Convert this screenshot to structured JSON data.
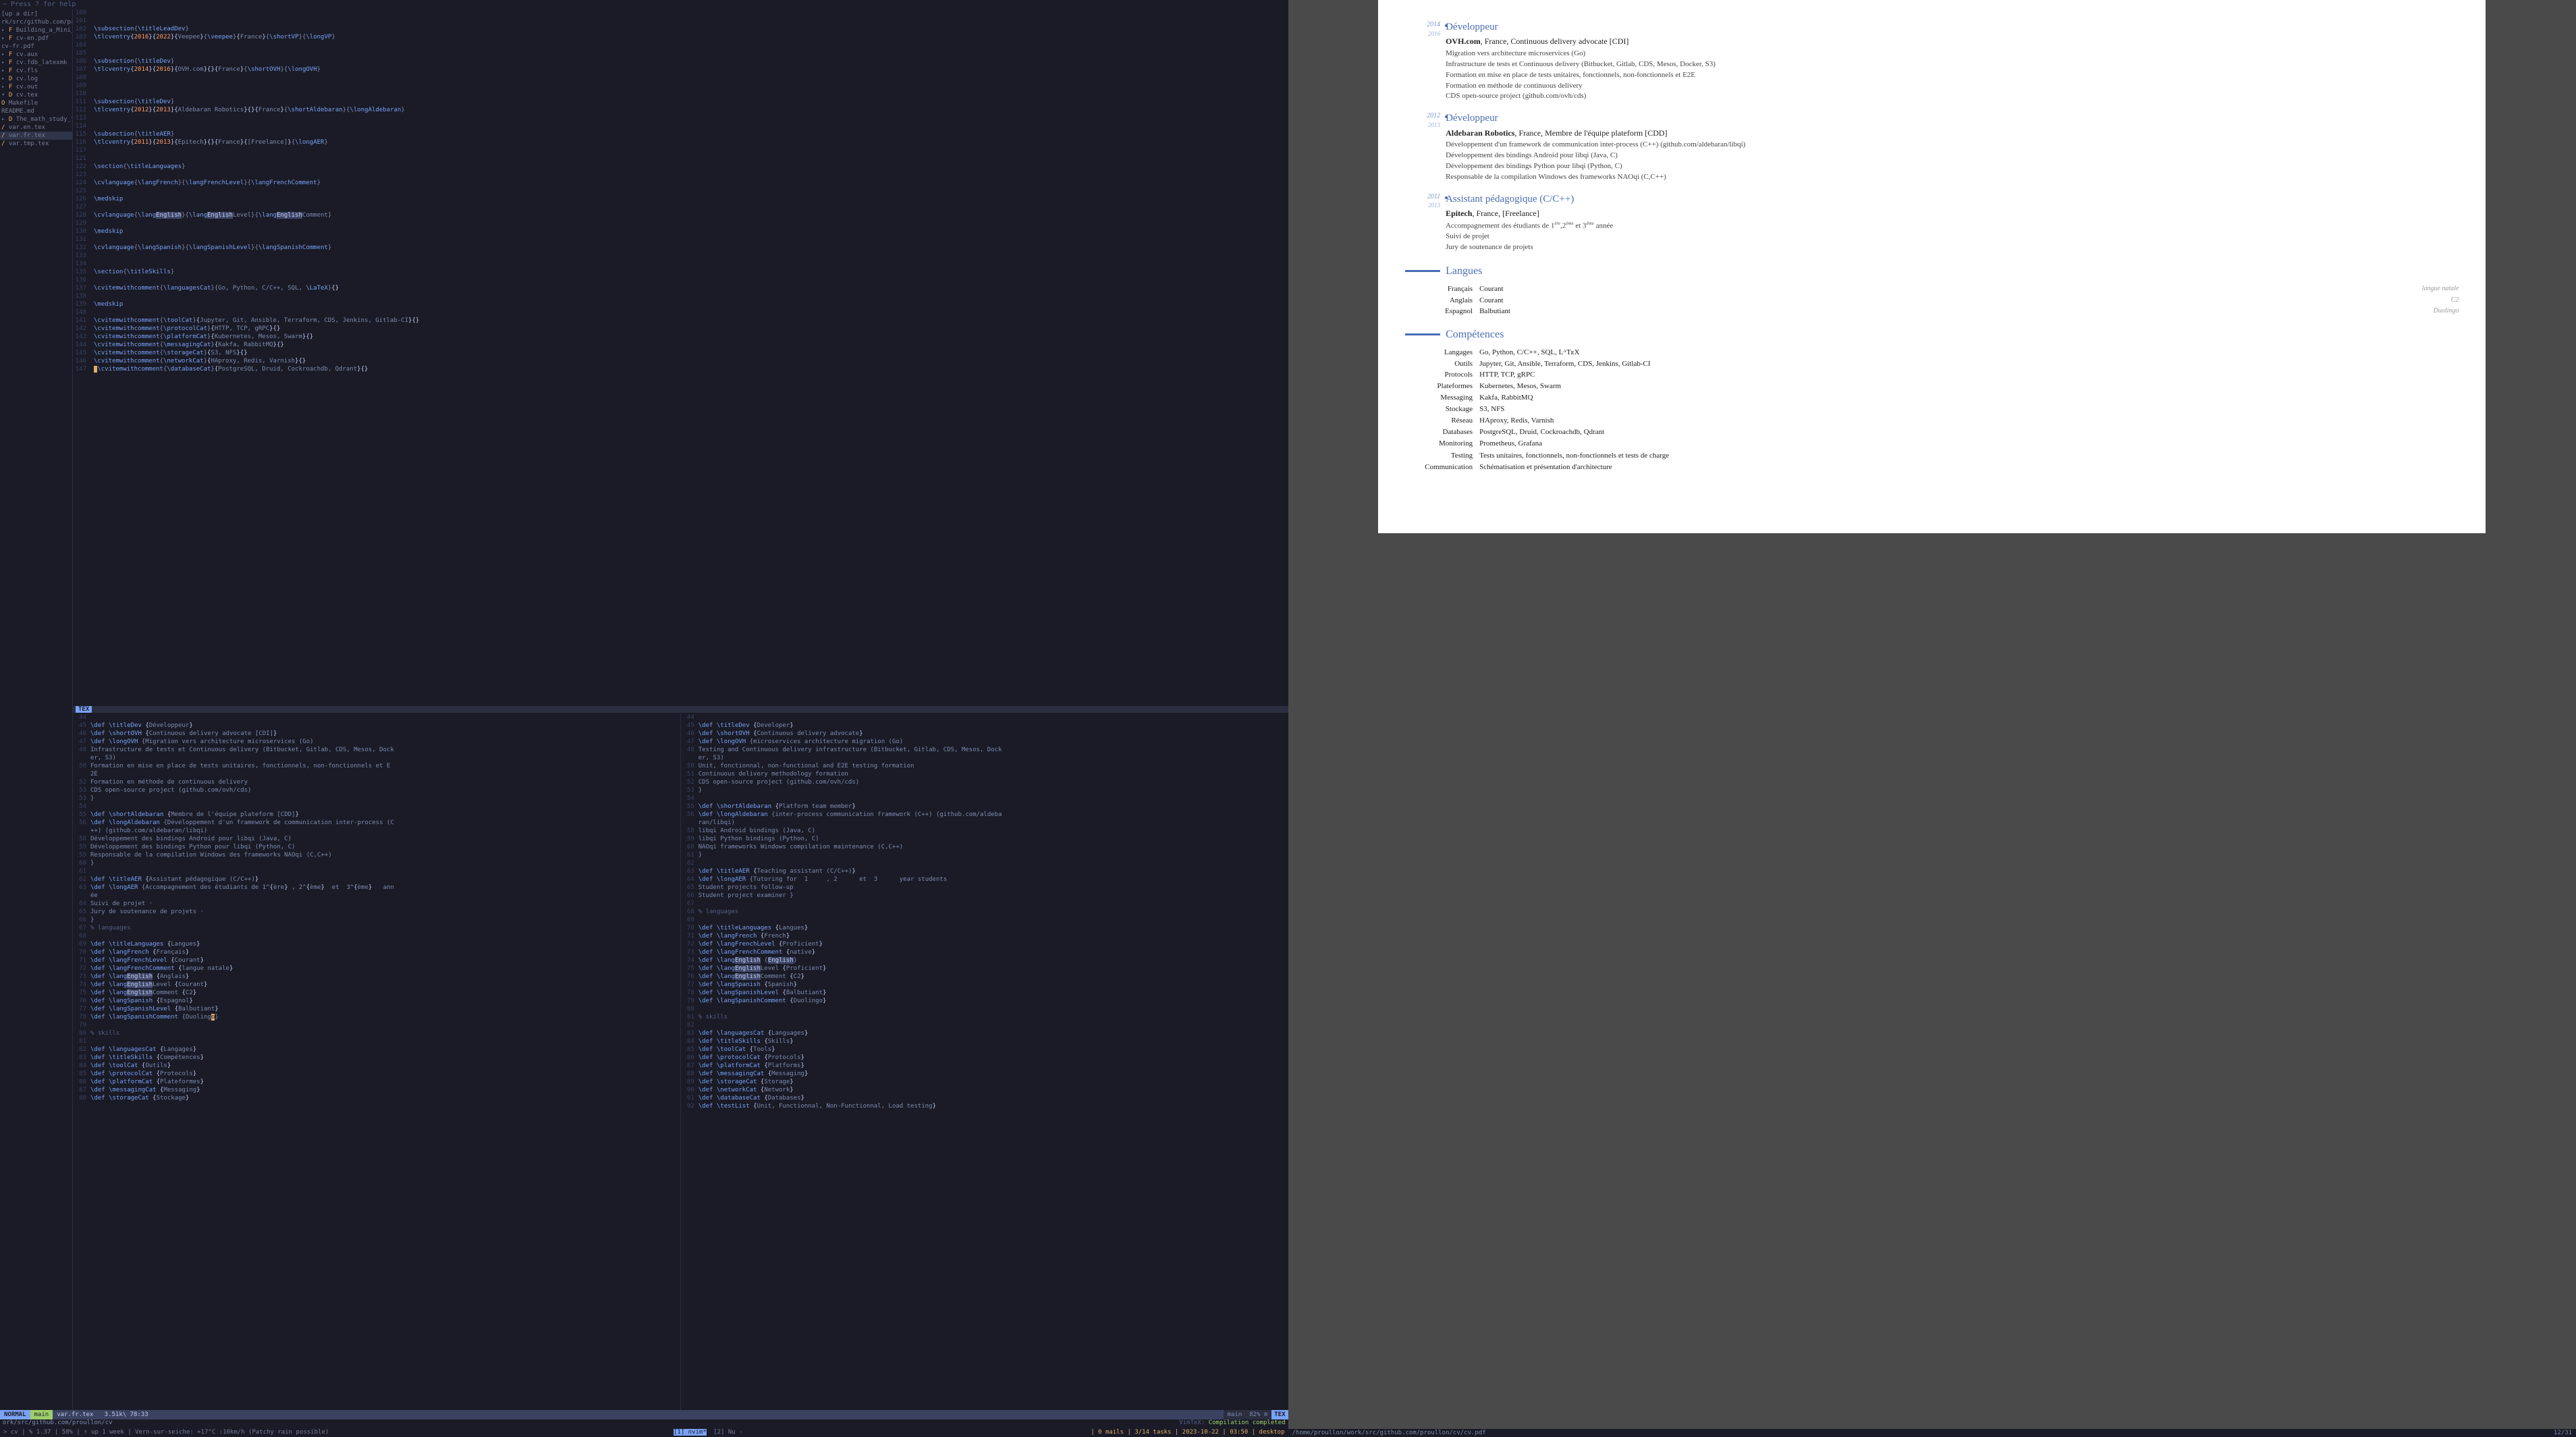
{
  "help": "~ Press ? for help",
  "file_tree": {
    "root": "[up a dir]",
    "path": "rk/src/github.com/proullon/cv/",
    "items": [
      {
        "exp": "▸",
        "mod": "F",
        "name": "Building_a_Mini_Workshop…"
      },
      {
        "exp": "▸",
        "mod": "F",
        "name": "cv-en.pdf"
      },
      {
        "exp": " ",
        "mod": " ",
        "name": "cv-fr.pdf"
      },
      {
        "exp": "▸",
        "mod": "F",
        "name": "cv.aux"
      },
      {
        "exp": "▸",
        "mod": "F",
        "name": "cv.fdb_latexmk"
      },
      {
        "exp": "▸",
        "mod": "F",
        "name": "cv.fls"
      },
      {
        "exp": "▸",
        "mod": "D",
        "name": "cv.log"
      },
      {
        "exp": "▸",
        "mod": "F",
        "name": "cv.out"
      },
      {
        "exp": "▾",
        "mod": "D",
        "name": "cv.tex",
        "sel": false
      },
      {
        "exp": " ",
        "mod": "O",
        "name": "Makefile"
      },
      {
        "exp": " ",
        "mod": " ",
        "name": "README.md"
      },
      {
        "exp": "▸",
        "mod": "D",
        "name": "The_math_study_tip_they_a…"
      },
      {
        "exp": " ",
        "mod": "/",
        "name": "var.en.tex"
      },
      {
        "exp": " ",
        "mod": "/",
        "name": "var.fr.tex",
        "sel": true
      },
      {
        "exp": " ",
        "mod": "/",
        "name": "var.tmp.tex"
      }
    ]
  },
  "main_code": {
    "lines": [
      {
        "n": 100,
        "t": ""
      },
      {
        "n": 101,
        "t": ""
      },
      {
        "n": 102,
        "t": "\\subsection{\\titleLeadDev}"
      },
      {
        "n": 103,
        "t": "\\tlcventry{2016}{2022}{Veepee}{\\veepee}{France}{\\shortVP}{\\longVP}"
      },
      {
        "n": 104,
        "t": ""
      },
      {
        "n": 105,
        "t": ""
      },
      {
        "n": 106,
        "t": "\\subsection{\\titleDev}"
      },
      {
        "n": 107,
        "t": "\\tlcventry{2014}{2016}{OVH.com}{}{France}{\\shortOVH}{\\longOVH}"
      },
      {
        "n": 108,
        "t": ""
      },
      {
        "n": 109,
        "t": ""
      },
      {
        "n": 110,
        "t": ""
      },
      {
        "n": 111,
        "t": "\\subsection{\\titleDev}"
      },
      {
        "n": 112,
        "t": "\\tlcventry{2012}{2013}{Aldebaran Robotics}{}{France}{\\shortAldebaran}{\\longAldebaran}"
      },
      {
        "n": 113,
        "t": ""
      },
      {
        "n": 114,
        "t": ""
      },
      {
        "n": 115,
        "t": "\\subsection{\\titleAER}"
      },
      {
        "n": 116,
        "t": "\\tlcventry{2011}{2013}{Epitech}{}{France}{[Freelance]}{\\longAER}"
      },
      {
        "n": 117,
        "t": ""
      },
      {
        "n": 121,
        "t": ""
      },
      {
        "n": 122,
        "t": "\\section{\\titleLanguages}"
      },
      {
        "n": 123,
        "t": ""
      },
      {
        "n": 124,
        "t": "\\cvlanguage{\\langFrench}{\\langFrenchLevel}{\\langFrenchComment}"
      },
      {
        "n": 125,
        "t": ""
      },
      {
        "n": 126,
        "t": "\\medskip"
      },
      {
        "n": 127,
        "t": ""
      },
      {
        "n": 128,
        "t": "\\cvlanguage{\\lang",
        "hl": "English",
        "t2": "}{\\lang",
        "hl2": "English",
        "t3": "Level}{\\lang",
        "hl3": "English",
        "t4": "Comment}"
      },
      {
        "n": 129,
        "t": ""
      },
      {
        "n": 130,
        "t": "\\medskip"
      },
      {
        "n": 131,
        "t": ""
      },
      {
        "n": 132,
        "t": "\\cvlanguage{\\langSpanish}{\\langSpanishLevel}{\\langSpanishComment}"
      },
      {
        "n": 133,
        "t": ""
      },
      {
        "n": 134,
        "t": ""
      },
      {
        "n": 135,
        "t": "\\section{\\titleSkills}"
      },
      {
        "n": 136,
        "t": ""
      },
      {
        "n": 137,
        "t": "\\cvitemwithcomment{\\languagesCat}{Go, Python, C/C++, SQL, \\LaTeX}{}"
      },
      {
        "n": 138,
        "t": ""
      },
      {
        "n": 139,
        "t": "\\medskip"
      },
      {
        "n": 140,
        "t": ""
      },
      {
        "n": 141,
        "t": "\\cvitemwithcomment{\\toolCat}{Jupyter, Git, Ansible, Terraform, CDS, Jenkins, Gitlab-CI}{}"
      },
      {
        "n": 142,
        "t": "\\cvitemwithcomment{\\protocolCat}{HTTP, TCP, gRPC}{}"
      },
      {
        "n": 143,
        "t": "\\cvitemwithcomment{\\platformCat}{Kubernetes, Mesos, Swarm}{}"
      },
      {
        "n": 144,
        "t": "\\cvitemwithcomment{\\messagingCat}{Kakfa, RabbitMQ}{}"
      },
      {
        "n": 145,
        "t": "\\cvitemwithcomment{\\storageCat}{S3, NFS}{}"
      },
      {
        "n": 146,
        "t": "\\cvitemwithcomment{\\networkCat}{HAproxy, Redis, Varnish}{}"
      },
      {
        "n": 147,
        "t": "\\cvitemwithcomment{\\databaseCat}{PostgreSQL, Druid, Cockroachdb, Qdrant}{}",
        "cur": true
      }
    ]
  },
  "bottom_left": {
    "lines": [
      {
        "n": 44,
        "t": ""
      },
      {
        "n": 45,
        "t": "\\def \\titleDev {Développeur}"
      },
      {
        "n": 46,
        "t": "\\def \\shortOVH {Continuous delivery advocate [CDI]}"
      },
      {
        "n": 47,
        "t": "\\def \\longOVH {Migration vers architecture microservices (Go)"
      },
      {
        "n": 48,
        "t": "Infrastructure de tests et Continuous delivery (Bitbucket, Gitlab, CDS, Mesos, Dock"
      },
      {
        "n": "  ",
        "t": "er, S3)"
      },
      {
        "n": 50,
        "t": "Formation en mise en place de tests unitaires, fonctionnels, non-fonctionnels et E"
      },
      {
        "n": "  ",
        "t": "2E"
      },
      {
        "n": 52,
        "t": "Formation en méthode de continuous delivery"
      },
      {
        "n": 53,
        "t": "CDS open-source project (github.com/ovh/cds)"
      },
      {
        "n": 53,
        "t": "}"
      },
      {
        "n": 54,
        "t": ""
      },
      {
        "n": 55,
        "t": "\\def \\shortAldebaran {Membre de l'équipe plateform [CDD]}"
      },
      {
        "n": 56,
        "t": "\\def \\longAldebaran {Développement d'un framework de communication inter-process (C"
      },
      {
        "n": "  ",
        "t": "++) (github.com/aldebaran/libqi)"
      },
      {
        "n": 58,
        "t": "Développement des bindings Android pour libqi (Java, C)"
      },
      {
        "n": 59,
        "t": "Développement des bindings Python pour libqi (Python, C)"
      },
      {
        "n": 59,
        "t": "Responsable de la compilation Windows des frameworks NAOqi (C,C++)"
      },
      {
        "n": 60,
        "t": "}"
      },
      {
        "n": 61,
        "t": ""
      },
      {
        "n": 62,
        "t": "\\def \\titleAER {Assistant pédagogique (C/C++)}"
      },
      {
        "n": 63,
        "t": "\\def \\longAER {Accompagnement des étudiants de 1^{ère} , 2^{ème}  et  3^{ème}   ann"
      },
      {
        "n": "  ",
        "t": "ée"
      },
      {
        "n": 64,
        "t": "Suivi de projet ·"
      },
      {
        "n": 65,
        "t": "Jury de soutenance de projets ·"
      },
      {
        "n": 66,
        "t": "}"
      },
      {
        "n": 67,
        "t": "% languages"
      },
      {
        "n": 68,
        "t": ""
      },
      {
        "n": 69,
        "t": "\\def \\titleLanguages {Langues}"
      },
      {
        "n": 70,
        "t": "\\def \\langFrench {Français}"
      },
      {
        "n": 71,
        "t": "\\def \\langFrenchLevel {Courant}"
      },
      {
        "n": 72,
        "t": "\\def \\langFrenchComment {langue natale}"
      },
      {
        "n": 73,
        "t": "\\def \\lang",
        "hl": "English",
        "t2": " {Anglais}"
      },
      {
        "n": 74,
        "t": "\\def \\lang",
        "hl": "English",
        "t2": "Level {Courant}"
      },
      {
        "n": 75,
        "t": "\\def \\lang",
        "hl": "English",
        "t2": "Comment {C2}"
      },
      {
        "n": 76,
        "t": "\\def \\langSpanish {Espagnol}"
      },
      {
        "n": 77,
        "t": "\\def \\langSpanishLevel {Balbutiant}"
      },
      {
        "n": 78,
        "t": "\\def \\langSpanishComment {Duoling",
        "cur": "o",
        "t2": "}"
      },
      {
        "n": 79,
        "t": ""
      },
      {
        "n": 80,
        "t": "% skills"
      },
      {
        "n": 81,
        "t": ""
      },
      {
        "n": 82,
        "t": "\\def \\languagesCat {Langages}"
      },
      {
        "n": 83,
        "t": "\\def \\titleSkills {Compétences}"
      },
      {
        "n": 84,
        "t": "\\def \\toolCat {Outils}"
      },
      {
        "n": 85,
        "t": "\\def \\protocolCat {Protocols}"
      },
      {
        "n": 86,
        "t": "\\def \\platformCat {Plateformes}"
      },
      {
        "n": 87,
        "t": "\\def \\messagingCat {Messaging}"
      },
      {
        "n": 88,
        "t": "\\def \\storageCat {Stockage}"
      }
    ]
  },
  "bottom_right": {
    "lines": [
      {
        "n": 44,
        "t": ""
      },
      {
        "n": 45,
        "t": "\\def \\titleDev {Developer}"
      },
      {
        "n": 46,
        "t": "\\def \\shortOVH {Continuous delivery advocate}"
      },
      {
        "n": 47,
        "t": "\\def \\longOVH {microservices architecture migration (Go)"
      },
      {
        "n": 48,
        "t": "Testing and Continuous delivery infrastructure (Bitbucket, Gitlab, CDS, Mesos, Dock"
      },
      {
        "n": "  ",
        "t": "er, S3)"
      },
      {
        "n": 50,
        "t": "Unit, fonctionnal, non-functional and E2E testing formation"
      },
      {
        "n": 51,
        "t": "Continuous delivery methodology formation"
      },
      {
        "n": 52,
        "t": "CDS open-source project (github.com/ovh/cds)"
      },
      {
        "n": 53,
        "t": "}"
      },
      {
        "n": 54,
        "t": ""
      },
      {
        "n": 55,
        "t": "\\def \\shortAldebaran {Platform team member}"
      },
      {
        "n": 56,
        "t": "\\def \\longAldebaran {inter-process communication framework (C++) (github.com/aldeba"
      },
      {
        "n": "  ",
        "t": "ran/libqi)"
      },
      {
        "n": 58,
        "t": "libqi Android bindings (Java, C)"
      },
      {
        "n": 59,
        "t": "libqi Python bindings (Python, C)"
      },
      {
        "n": 60,
        "t": "NAOqi frameworks Windows compilation maintenance (C,C++)"
      },
      {
        "n": 61,
        "t": "}"
      },
      {
        "n": 62,
        "t": ""
      },
      {
        "n": 63,
        "t": "\\def \\titleAER {Teaching assistant (C/C++)}"
      },
      {
        "n": 64,
        "t": "\\def \\longAER {Tutoring for  1     , 2      et  3      year students"
      },
      {
        "n": 65,
        "t": "Student projects follow-up"
      },
      {
        "n": 66,
        "t": "Student project examiner }"
      },
      {
        "n": 67,
        "t": ""
      },
      {
        "n": 68,
        "t": "% languages"
      },
      {
        "n": 69,
        "t": ""
      },
      {
        "n": 70,
        "t": "\\def \\titleLanguages {Langues}"
      },
      {
        "n": 71,
        "t": "\\def \\langFrench {French}"
      },
      {
        "n": 72,
        "t": "\\def \\langFrenchLevel {Proficient}"
      },
      {
        "n": 73,
        "t": "\\def \\langFrenchComment {native}"
      },
      {
        "n": 74,
        "t": "\\def \\lang",
        "hl": "English",
        "t2": " {",
        "hl2": "English",
        "t3": "}"
      },
      {
        "n": 75,
        "t": "\\def \\lang",
        "hl": "English",
        "t2": "Level {Proficient}"
      },
      {
        "n": 76,
        "t": "\\def \\lang",
        "hl": "English",
        "t2": "Comment {C2}"
      },
      {
        "n": 77,
        "t": "\\def \\langSpanish {Spanish}"
      },
      {
        "n": 78,
        "t": "\\def \\langSpanishLevel {Balbutiant}"
      },
      {
        "n": 79,
        "t": "\\def \\langSpanishComment {Duolingo}"
      },
      {
        "n": 80,
        "t": ""
      },
      {
        "n": 81,
        "t": "% skills"
      },
      {
        "n": 82,
        "t": ""
      },
      {
        "n": 83,
        "t": "\\def \\languagesCat {Languages}"
      },
      {
        "n": 84,
        "t": "\\def \\titleSkills {Skills}"
      },
      {
        "n": 85,
        "t": "\\def \\toolCat {Tools}"
      },
      {
        "n": 86,
        "t": "\\def \\protocolCat {Protocols}"
      },
      {
        "n": 87,
        "t": "\\def \\platformCat {Platforms}"
      },
      {
        "n": 88,
        "t": "\\def \\messagingCat {Messaging}"
      },
      {
        "n": 89,
        "t": "\\def \\storageCat {Storage}"
      },
      {
        "n": 90,
        "t": "\\def \\networkCat {Network}"
      },
      {
        "n": 91,
        "t": "\\def \\databaseCat {Databases}"
      },
      {
        "n": 92,
        "t": "\\def \\testList {Unit, Functionnal, Non-Functionnal, Load testing}"
      }
    ]
  },
  "status": {
    "mode": "NORMAL",
    "git": " main",
    "file": "var.fr.tex",
    "sizepos": "3.51k\\  78:33",
    "right_pct": "82% ≡",
    "right_lang": "TEX",
    "left_lang_tab": "TEX",
    "path": "ork/src/github.com/proullon/cv",
    "vimtex_label": "VimTeX:",
    "vimtex_msg": "Compilation completed",
    "nu_label": "Nu -",
    "nvim_label": "[1] nvim*",
    "nu_win": "[2]"
  },
  "tmux": {
    "left": "> cv | % 1.37 | 58%  | ↑ up 1 week | Vern-sur-seiche: +17°C :10km/h (Patchy rain possible)",
    "mid": "",
    "right": "| 0 mails | 3/14 tasks | 2023-10-22 | 03:50  | desktop"
  },
  "pdf": {
    "entries": [
      {
        "y1": "2014",
        "y2": "2016",
        "role": "Développeur",
        "company": "OVH.com",
        "meta": ", France, Continuous delivery advocate [CDI]",
        "desc": [
          "Migration vers architecture microservices (Go)",
          "Infrastructure de tests et Continuous delivery (Bitbucket, Gitlab, CDS, Mesos, Docker, S3)",
          "Formation en mise en place de tests unitaires, fonctionnels, non-fonctionnels et E2E",
          "Formation en méthode de continuous delivery",
          "CDS open-source project (github.com/ovh/cds)"
        ]
      },
      {
        "y1": "2012",
        "y2": "2013",
        "role": "Développeur",
        "company": "Aldebaran Robotics",
        "meta": ", France, Membre de l'équipe plateform [CDD]",
        "desc": [
          "Développement d'un framework de communication inter-process (C++) (github.com/aldebaran/libqi)",
          "Développement des bindings Android pour libqi (Java, C)",
          "Développement des bindings Python pour libqi (Python, C)",
          "Responsable de la compilation Windows des frameworks NAOqi (C,C++)"
        ]
      },
      {
        "y1": "2011",
        "y2": "2013",
        "role": "Assistant pédagogique (C/C++)",
        "company": "Epitech",
        "meta": ", France, [Freelance]",
        "desc": [
          "Accompagnement des étudiants de 1<sup>ère</sup>,2<sup>ème</sup> et 3<sup>ème</sup> année",
          "Suivi de projet",
          "Jury de soutenance de projets"
        ]
      }
    ],
    "langues_title": "Langues",
    "langues": [
      {
        "k": "Français",
        "v": "Courant",
        "n": "langue natale"
      },
      {
        "k": "Anglais",
        "v": "Courant",
        "n": "C2"
      },
      {
        "k": "Espagnol",
        "v": "Balbutiant",
        "n": "Duolingo"
      }
    ],
    "comp_title": "Compétences",
    "comp": [
      {
        "k": "Langages",
        "v": "Go, Python, C/C++, SQL, LᴬTᴇX"
      },
      {
        "k": "Outils",
        "v": "Jupyter, Git, Ansible, Terraform, CDS, Jenkins, Gitlab-CI"
      },
      {
        "k": "Protocols",
        "v": "HTTP, TCP, gRPC"
      },
      {
        "k": "Plateformes",
        "v": "Kubernetes, Mesos, Swarm"
      },
      {
        "k": "Messaging",
        "v": "Kakfa, RabbitMQ"
      },
      {
        "k": "Stockage",
        "v": "S3, NFS"
      },
      {
        "k": "Réseau",
        "v": "HAproxy, Redis, Varnish"
      },
      {
        "k": "Databases",
        "v": "PostgreSQL, Druid, Cockroachdb, Qdrant"
      },
      {
        "k": "Monitoring",
        "v": "Prometheus, Grafana"
      },
      {
        "k": "",
        "v": ""
      },
      {
        "k": "Testing",
        "v": "Tests unitaires, fonctionnels, non-fonctionnels et tests de charge"
      },
      {
        "k": "Communication",
        "v": "Schématisation et présentation d'architecture"
      }
    ],
    "foot_path": "/home/proullon/work/src/github.com/proullon/cv/cv.pdf",
    "foot_page": "12/31"
  }
}
